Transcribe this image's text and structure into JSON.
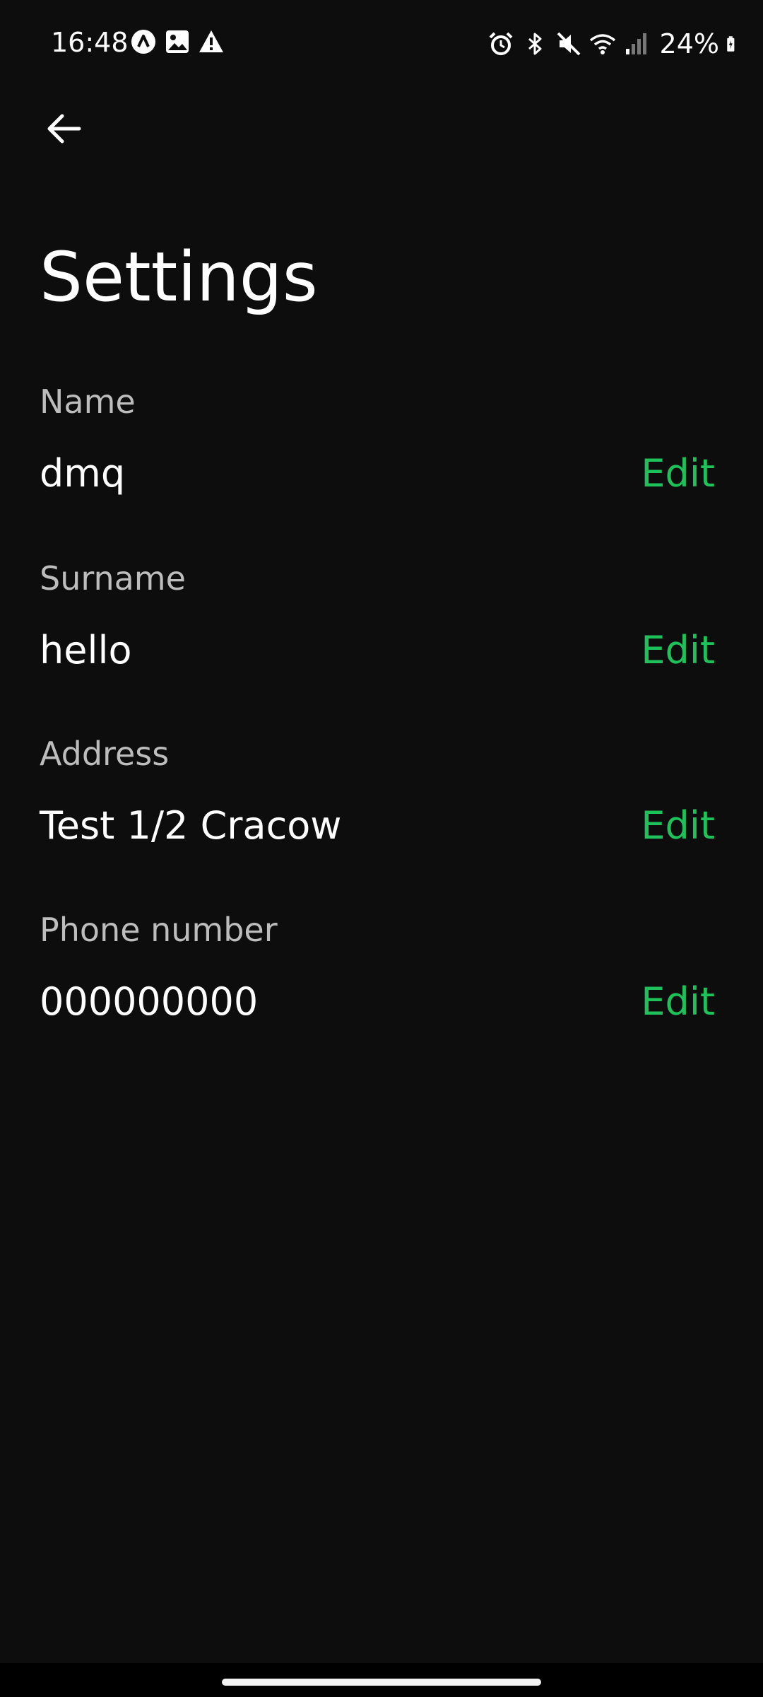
{
  "status_bar": {
    "time": "16:48",
    "battery": "24%",
    "left_icons": [
      "app-notification-icon",
      "image-icon",
      "warning-icon"
    ],
    "right_icons": [
      "alarm-icon",
      "bluetooth-icon",
      "mute-icon",
      "wifi-icon",
      "signal-icon",
      "battery-icon"
    ]
  },
  "header": {
    "title": "Settings"
  },
  "fields": [
    {
      "label": "Name",
      "value": "dmq",
      "action": "Edit"
    },
    {
      "label": "Surname",
      "value": "hello",
      "action": "Edit"
    },
    {
      "label": "Address",
      "value": "Test 1/2 Cracow",
      "action": "Edit"
    },
    {
      "label": "Phone number",
      "value": "000000000",
      "action": "Edit"
    }
  ],
  "colors": {
    "background": "#0d0d0d",
    "accent": "#1fc15b",
    "label": "#bdbdbd",
    "text": "#ffffff"
  }
}
